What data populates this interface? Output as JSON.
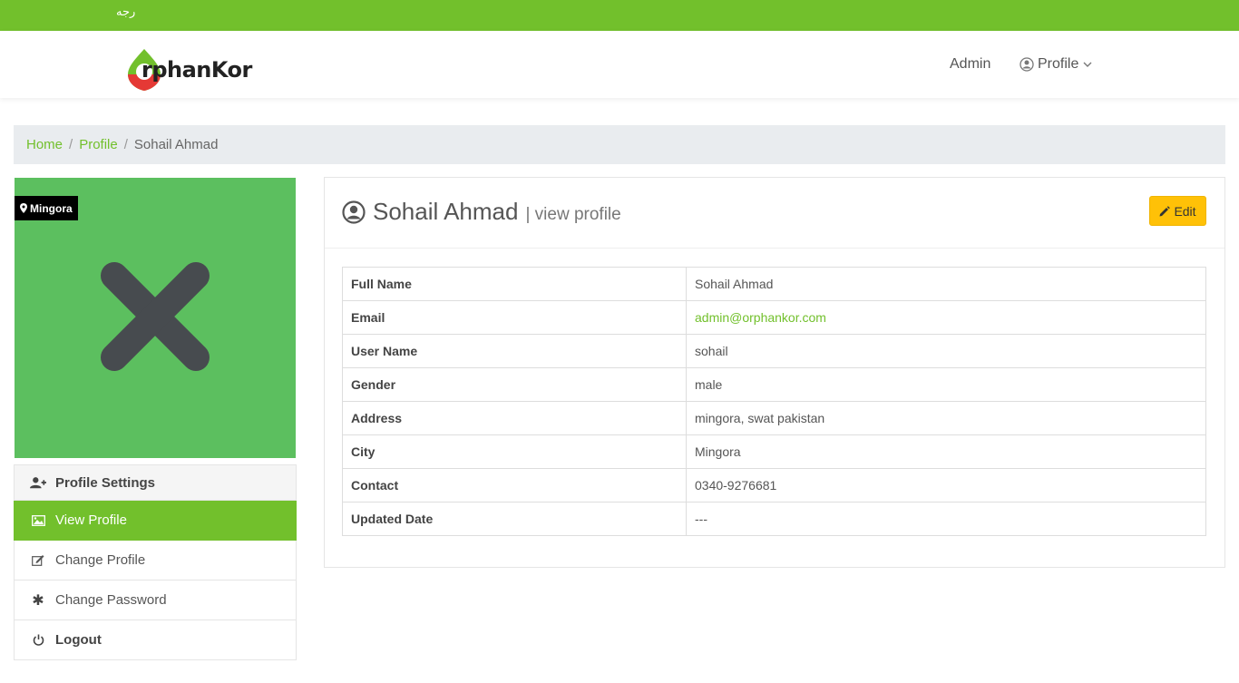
{
  "topbar": {
    "language": "ﺭﺟﻪ"
  },
  "header": {
    "logo_text": "rphanKor",
    "logo_letter": "O",
    "nav": {
      "admin": "Admin",
      "profile": "Profile"
    }
  },
  "breadcrumb": [
    "Home",
    "Profile",
    "Sohail Ahmad"
  ],
  "sidebar": {
    "location": "Mingora",
    "menu": {
      "header": "Profile Settings",
      "items": [
        "View Profile",
        "Change Profile",
        "Change Password"
      ],
      "logout": "Logout"
    }
  },
  "profile": {
    "name": "Sohail Ahmad",
    "subtitle": "| view profile",
    "edit_label": "Edit",
    "fields": [
      {
        "label": "Full Name",
        "value": "Sohail Ahmad"
      },
      {
        "label": "Email",
        "value": "admin@orphankor.com"
      },
      {
        "label": "User Name",
        "value": "sohail"
      },
      {
        "label": "Gender",
        "value": "male"
      },
      {
        "label": "Address",
        "value": "mingora, swat pakistan"
      },
      {
        "label": "City",
        "value": "Mingora"
      },
      {
        "label": "Contact",
        "value": "0340-9276681"
      },
      {
        "label": "Updated Date",
        "value": "---"
      }
    ]
  },
  "colors": {
    "brand": "#72c02c",
    "avatar_bg": "#5cbf5f",
    "edit": "#ffc107"
  }
}
